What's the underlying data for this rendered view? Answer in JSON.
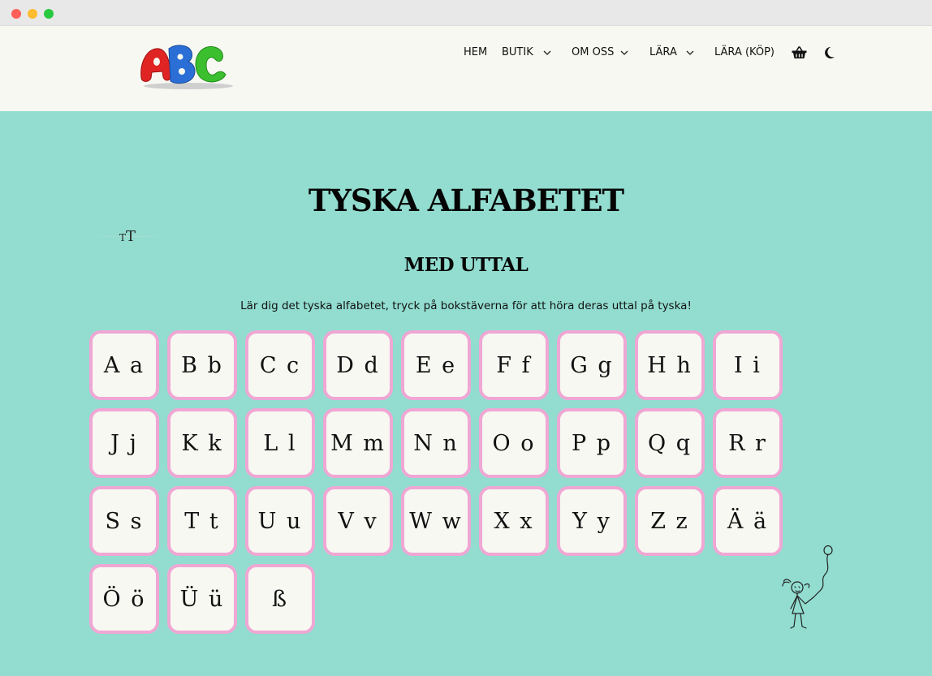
{
  "window": {
    "controls": [
      "close",
      "minimize",
      "maximize"
    ]
  },
  "header": {
    "logo": {
      "letters": [
        "A",
        "B",
        "C"
      ],
      "colors": [
        "#e02424",
        "#2b6fd6",
        "#3bbf2f"
      ]
    },
    "nav": [
      {
        "label": "HEM",
        "has_dropdown": false
      },
      {
        "label": "BUTIK",
        "has_dropdown": true
      },
      {
        "label": "OM OSS",
        "has_dropdown": true
      },
      {
        "label": "LÄRA",
        "has_dropdown": true
      },
      {
        "label": "LÄRA (KÖP)",
        "has_dropdown": false
      }
    ],
    "icons": [
      "basket-icon",
      "moon-icon"
    ]
  },
  "main": {
    "title": "TYSKA ALFABETET",
    "text_size_control": {
      "icon": "text-size-icon",
      "small": "T",
      "large": "T"
    },
    "subtitle": "MED UTTAL",
    "intro": "Lär dig det tyska alfabetet, tryck på bokstäverna för att höra deras uttal på tyska!",
    "letters": [
      "A a",
      "B b",
      "C c",
      "D d",
      "E e",
      "F f",
      "G g",
      "H h",
      "I i",
      "J j",
      "K k",
      "L l",
      "M m",
      "N n",
      "O o",
      "P p",
      "Q q",
      "R r",
      "S s",
      "T t",
      "U u",
      "V v",
      "W w",
      "X x",
      "Y y",
      "Z z",
      "Ä ä",
      "Ö ö",
      "Ü ü",
      "ß"
    ]
  },
  "colors": {
    "background": "#92ddd0",
    "header_bg": "#f8f8f2",
    "card_border": "#efa7d4",
    "card_bg": "#f8f8f2"
  }
}
